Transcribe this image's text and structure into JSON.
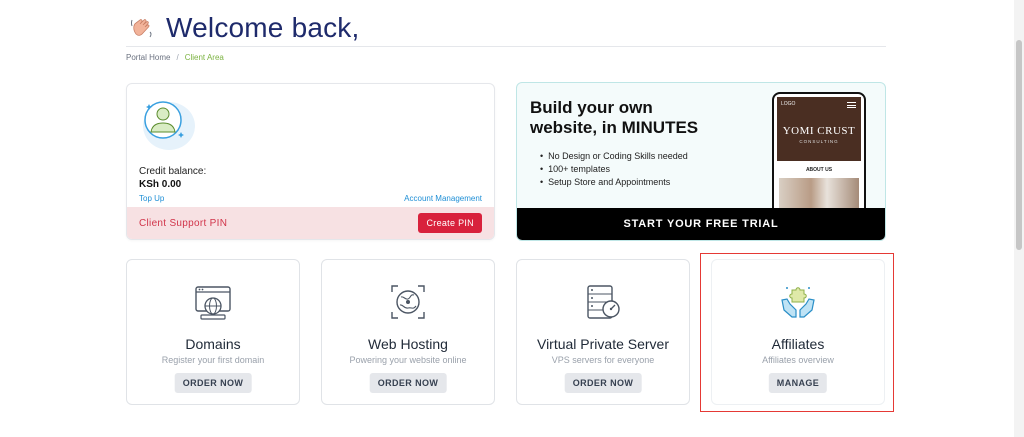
{
  "header": {
    "title": "Welcome back,",
    "wave_icon": "waving-hand-icon"
  },
  "breadcrumb": {
    "items": [
      "Portal Home",
      "Client Area"
    ],
    "separator": "/"
  },
  "credit": {
    "label": "Credit balance:",
    "value": "KSh 0.00",
    "top_up": "Top Up",
    "account_management": "Account Management",
    "pin_label": "Client Support PIN",
    "pin_button": "Create PIN"
  },
  "promo": {
    "title_line1": "Build your own",
    "title_line2": "website, in MINUTES",
    "features": [
      "No Design or Coding Skills needed",
      "100+ templates",
      "Setup Store and Appointments"
    ],
    "cta": "START YOUR FREE TRIAL",
    "phone": {
      "logo": "LOGO",
      "brand": "YOMI CRUST",
      "brand_sub": "CONSULTING",
      "section": "ABOUT US"
    }
  },
  "services": [
    {
      "title": "Domains",
      "subtitle": "Register your first domain",
      "button": "ORDER NOW",
      "icon": "domain-browser-icon"
    },
    {
      "title": "Web Hosting",
      "subtitle": "Powering your website online",
      "button": "ORDER NOW",
      "icon": "globe-hosting-icon"
    },
    {
      "title": "Virtual Private Server",
      "subtitle": "VPS servers for everyone",
      "button": "ORDER NOW",
      "icon": "server-gauge-icon"
    },
    {
      "title": "Affiliates",
      "subtitle": "Affiliates overview",
      "button": "MANAGE",
      "icon": "hands-puzzle-icon"
    }
  ],
  "colors": {
    "brand_navy": "#1e2a6b",
    "danger": "#d8213c",
    "link": "#1f8fd6",
    "highlight": "#e53935"
  }
}
